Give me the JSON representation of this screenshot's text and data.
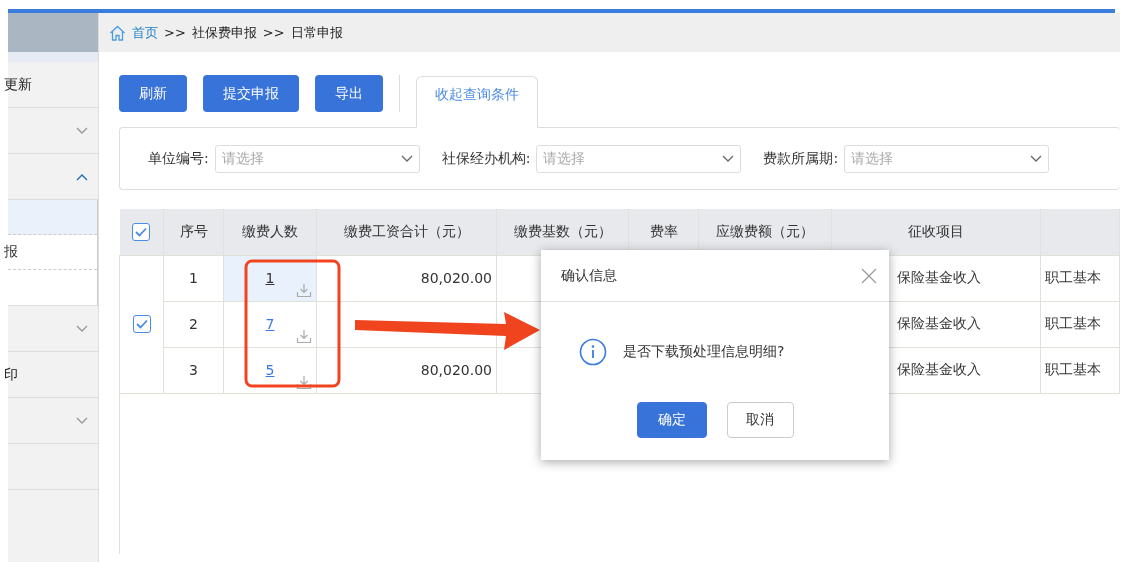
{
  "breadcrumb": {
    "items": [
      {
        "label": "首页",
        "link": true
      },
      {
        "label": "社保费申报",
        "link": false
      },
      {
        "label": "日常申报",
        "link": false
      }
    ],
    "separator": ">>"
  },
  "sidebar": {
    "items": [
      {
        "kind": "link",
        "label": "更新"
      },
      {
        "kind": "group",
        "expanded": false
      },
      {
        "kind": "group",
        "expanded": true,
        "children": [
          {
            "selected": true
          },
          {
            "label": "报",
            "selected": false
          }
        ]
      },
      {
        "kind": "group",
        "expanded": false
      },
      {
        "kind": "link",
        "label": "印"
      },
      {
        "kind": "group",
        "expanded": false
      }
    ]
  },
  "toolbar": {
    "buttons": [
      "刷新",
      "提交申报",
      "导出"
    ],
    "tab": "收起查询条件"
  },
  "filters": [
    {
      "label": "单位编号:",
      "placeholder": "请选择"
    },
    {
      "label": "社保经办机构:",
      "placeholder": "请选择"
    },
    {
      "label": "费款所属期:",
      "placeholder": "请选择"
    }
  ],
  "table": {
    "all_checked": true,
    "columns": [
      "序号",
      "缴费人数",
      "缴费工资合计（元）",
      "缴费基数（元）",
      "费率",
      "应缴费额（元）",
      "征收项目"
    ],
    "rows": [
      {
        "no": "1",
        "count": "1",
        "selected": true,
        "wage": "80,020.00",
        "item": "保险基金收入",
        "column_9": "职工基本"
      },
      {
        "no": "2",
        "count": "7",
        "selected": false,
        "item": "保险基金收入",
        "column_9": "职工基本"
      },
      {
        "no": "3",
        "count": "5",
        "selected": false,
        "wage": "80,020.00",
        "item": "保险基金收入",
        "column_9": "职工基本"
      }
    ],
    "group_checked": true
  },
  "dialog": {
    "title": "确认信息",
    "message": "是否下载预处理信息明细?",
    "buttons": [
      {
        "label": "确定",
        "primary": true
      },
      {
        "label": "取消",
        "primary": false
      }
    ]
  }
}
